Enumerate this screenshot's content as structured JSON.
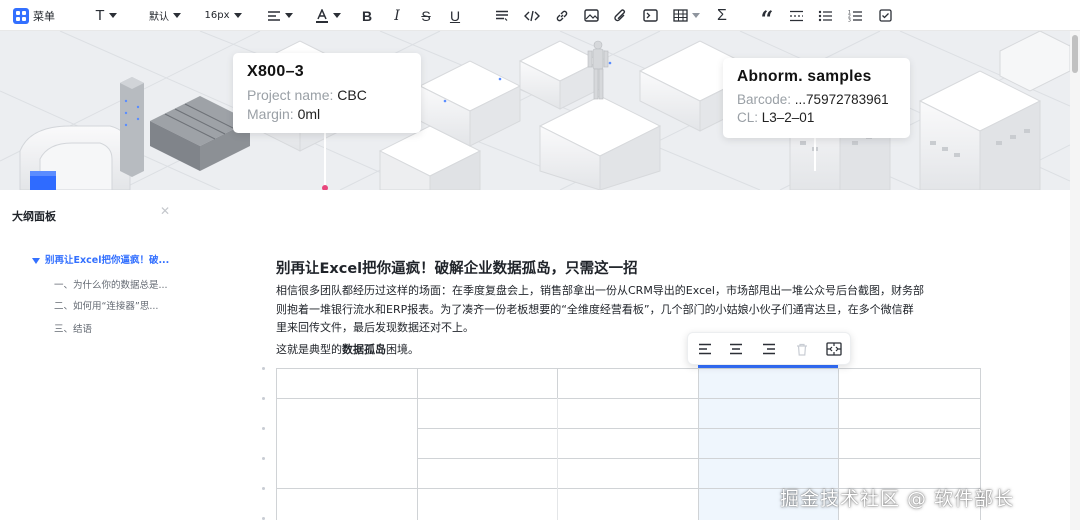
{
  "toolbar": {
    "menu_label": "菜单",
    "font_family": "默认",
    "font_size": "16px",
    "buttons": [
      "text-style",
      "align",
      "font-color",
      "bold",
      "italic",
      "strikethrough",
      "underline",
      "paragraph",
      "code",
      "link",
      "image",
      "attachment",
      "code-block",
      "table",
      "formula",
      "quote",
      "divider",
      "bullet-list",
      "ordered-list",
      "task-list"
    ]
  },
  "banner": {
    "callout_left": {
      "title": "X800–3",
      "project_label": "Project name: ",
      "project_value": "CBC",
      "margin_label": "Margin: ",
      "margin_value": "0ml"
    },
    "callout_right": {
      "title": "Abnorm. samples",
      "barcode_label": "Barcode: ",
      "barcode_value": "...75972783961",
      "cl_label": "CL: ",
      "cl_value": "L3–2–01"
    }
  },
  "outline": {
    "title": "大纲面板",
    "items": [
      {
        "level": 1,
        "label": "别再让Excel把你逼疯！破..."
      },
      {
        "level": 2,
        "label": "一、为什么你的数据总是..."
      },
      {
        "level": 2,
        "label": "二、如何用“连接器”思..."
      },
      {
        "level": 2,
        "label": "三、结语"
      }
    ]
  },
  "document": {
    "title": "别再让Excel把你逼疯！破解企业数据孤岛，只需这一招",
    "paragraph_lines": [
      "相信很多团队都经历过这样的场面：在季度复盘会上，销售部拿出一份从CRM导出的Excel，市场部甩出一堆公众号后台截图，财务部",
      "则抱着一堆银行流水和ERP报表。为了凑齐一份老板想要的“全维度经营看板”，几个部门的小姑娘小伙子们通宵达旦，在多个微信群",
      "里来回传文件，最后发现数据还对不上。"
    ],
    "para2_prefix": "这就是典型的",
    "para2_bold": "数据孤岛",
    "para2_suffix": "困境。"
  },
  "watermark": "掘金技术社区 @ 软件部长"
}
